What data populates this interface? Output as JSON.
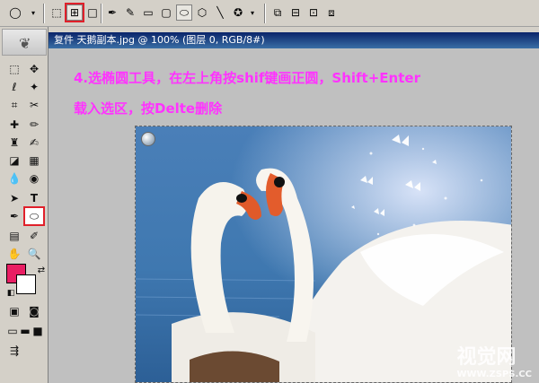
{
  "document": {
    "title": "复件 天鹅副本.jpg @ 100% (图层 0, RGB/8#)"
  },
  "instructions": {
    "line1": "4.选椭圆工具，在左上角按shif键画正圆，Shift+Enter",
    "line2": "载入选区，按Delte删除"
  },
  "watermark": {
    "brand": "视觉网",
    "url": "WWW.ZSPS.CC"
  },
  "colors": {
    "foreground": "#e91e63",
    "background": "#ffffff",
    "instruction_text": "#ff33ff",
    "highlight": "#e0202a"
  }
}
